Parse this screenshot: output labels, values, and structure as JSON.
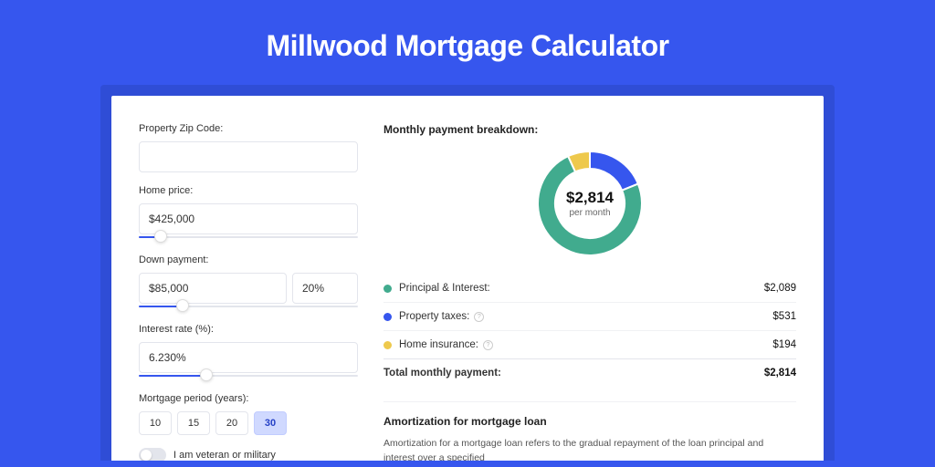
{
  "title": "Millwood Mortgage Calculator",
  "colors": {
    "principal": "#41ab8e",
    "taxes": "#3656ee",
    "insurance": "#eec94d"
  },
  "inputs": {
    "zip": {
      "label": "Property Zip Code:",
      "value": ""
    },
    "home_price": {
      "label": "Home price:",
      "value": "$425,000",
      "slider_pct": 10
    },
    "down_payment": {
      "label": "Down payment:",
      "amount": "$85,000",
      "percent": "20%",
      "slider_pct": 20
    },
    "interest_rate": {
      "label": "Interest rate (%):",
      "value": "6.230%",
      "slider_pct": 31
    },
    "period": {
      "label": "Mortgage period (years):",
      "options": [
        "10",
        "15",
        "20",
        "30"
      ],
      "selected": "30"
    },
    "veteran": {
      "label": "I am veteran or military",
      "on": false
    }
  },
  "breakdown": {
    "title": "Monthly payment breakdown:",
    "donut": {
      "amount": "$2,814",
      "sub": "per month"
    },
    "items": [
      {
        "color": "principal",
        "label": "Principal & Interest:",
        "info": false,
        "value": "$2,089"
      },
      {
        "color": "taxes",
        "label": "Property taxes:",
        "info": true,
        "value": "$531"
      },
      {
        "color": "insurance",
        "label": "Home insurance:",
        "info": true,
        "value": "$194"
      }
    ],
    "total": {
      "label": "Total monthly payment:",
      "value": "$2,814"
    }
  },
  "amort": {
    "title": "Amortization for mortgage loan",
    "text": "Amortization for a mortgage loan refers to the gradual repayment of the loan principal and interest over a specified"
  },
  "chart_data": {
    "type": "pie",
    "title": "Monthly payment breakdown",
    "series": [
      {
        "name": "Principal & Interest",
        "value": 2089,
        "color": "#41ab8e"
      },
      {
        "name": "Property taxes",
        "value": 531,
        "color": "#3656ee"
      },
      {
        "name": "Home insurance",
        "value": 194,
        "color": "#eec94d"
      }
    ],
    "total": 2814,
    "center_label": "$2,814 per month"
  }
}
